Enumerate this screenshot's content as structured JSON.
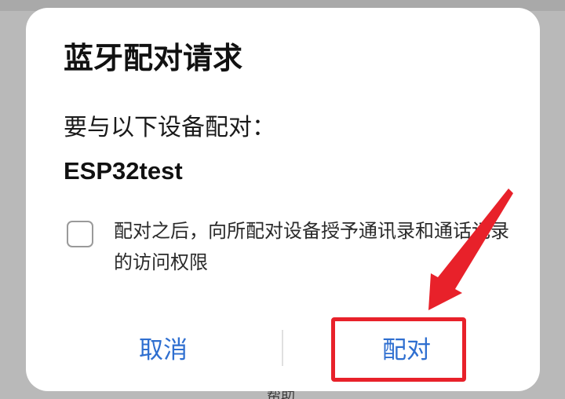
{
  "backdrop": {
    "bottom_text": "帮助"
  },
  "dialog": {
    "title": "蓝牙配对请求",
    "prompt": "要与以下设备配对：",
    "device_name": "ESP32test",
    "permission_checkbox": {
      "checked": false,
      "label": "配对之后，向所配对设备授予通讯录和通话记录的访问权限"
    },
    "buttons": {
      "cancel": "取消",
      "pair": "配对"
    },
    "accent_color": "#2f6fd0"
  },
  "annotation": {
    "highlight_color": "#e8212a",
    "target": "pair-button"
  }
}
